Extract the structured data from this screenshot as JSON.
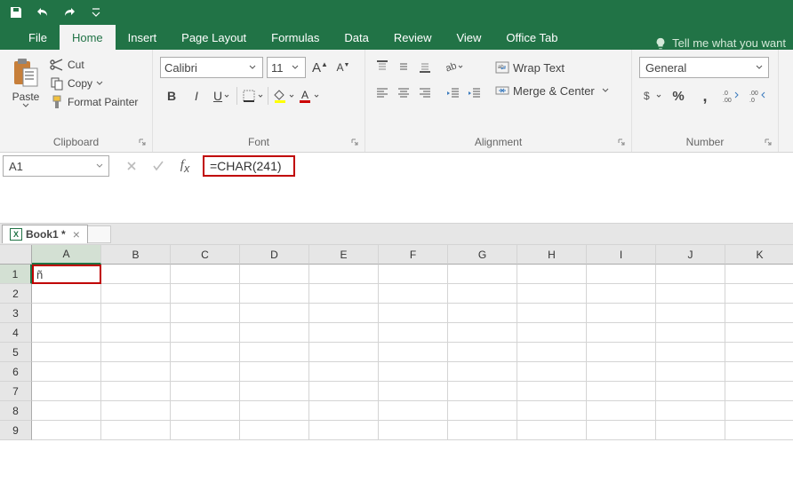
{
  "qat": {
    "save_tip": "Save",
    "undo_tip": "Undo",
    "redo_tip": "Redo"
  },
  "tabs": {
    "file": "File",
    "home": "Home",
    "insert": "Insert",
    "page_layout": "Page Layout",
    "formulas": "Formulas",
    "data": "Data",
    "review": "Review",
    "view": "View",
    "office_tab": "Office Tab",
    "tell_me": "Tell me what you want"
  },
  "ribbon": {
    "clipboard": {
      "paste": "Paste",
      "cut": "Cut",
      "copy": "Copy",
      "format_painter": "Format Painter",
      "label": "Clipboard"
    },
    "font": {
      "name": "Calibri",
      "size": "11",
      "bold": "B",
      "italic": "I",
      "underline": "U",
      "label": "Font"
    },
    "alignment": {
      "wrap": "Wrap Text",
      "merge": "Merge & Center",
      "label": "Alignment"
    },
    "number": {
      "format": "General",
      "percent": "%",
      "comma": ",",
      "label": "Number"
    }
  },
  "name_box": "A1",
  "formula": "=CHAR(241)",
  "workbook_tab": "Book1 *",
  "columns": [
    "A",
    "B",
    "C",
    "D",
    "E",
    "F",
    "G",
    "H",
    "I",
    "J",
    "K"
  ],
  "rows": [
    "1",
    "2",
    "3",
    "4",
    "5",
    "6",
    "7",
    "8",
    "9"
  ],
  "cells": {
    "A1": "ñ"
  },
  "chart_data": {
    "type": "table",
    "active_cell": "A1",
    "formula": "=CHAR(241)",
    "result": "ñ"
  }
}
